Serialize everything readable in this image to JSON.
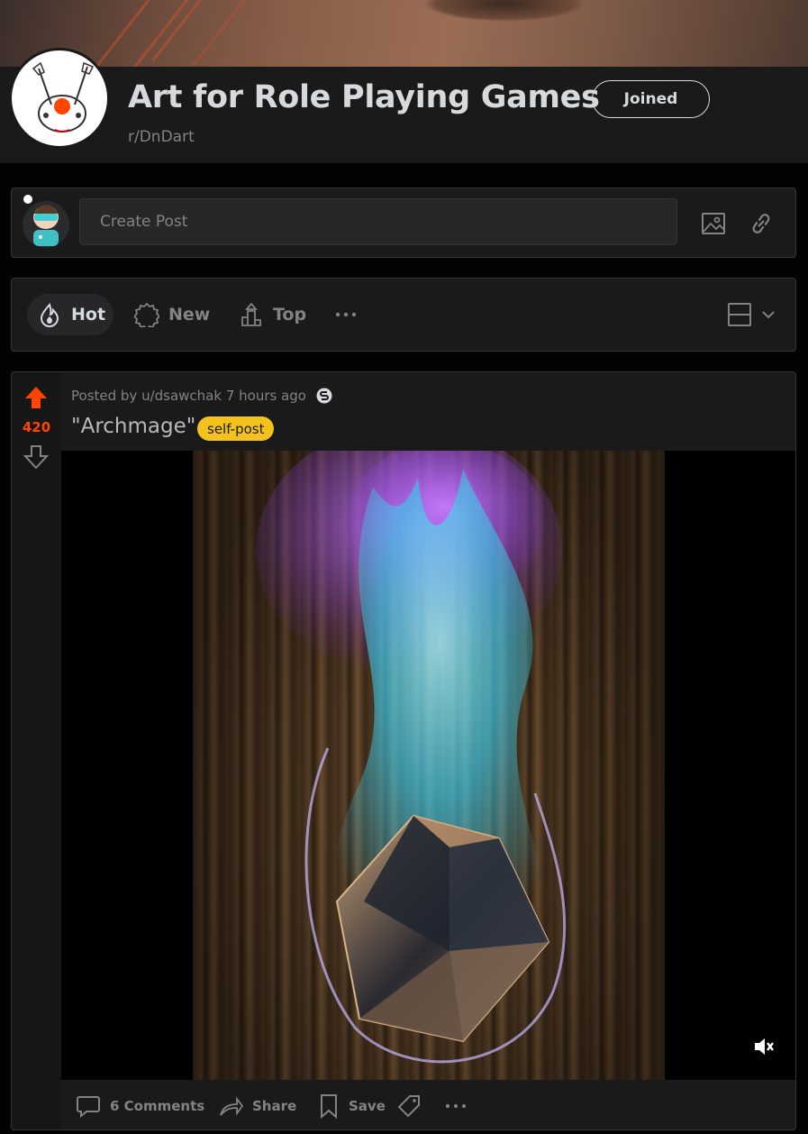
{
  "subreddit": {
    "title": "Art for Role Playing Games",
    "name": "r/DnDart",
    "join_label": "Joined"
  },
  "create_post": {
    "placeholder": "Create Post"
  },
  "sort": {
    "items": [
      {
        "label": "Hot",
        "icon": "flame-icon",
        "active": true
      },
      {
        "label": "New",
        "icon": "new-badge-icon",
        "active": false
      },
      {
        "label": "Top",
        "icon": "top-podium-icon",
        "active": false
      }
    ],
    "more": "more-options-icon",
    "view": "card-view-icon"
  },
  "post": {
    "votes": "420",
    "meta": "Posted by u/dsawchak 7 hours ago",
    "title": "\"Archmage\"",
    "flair": "self-post",
    "actions": {
      "comments": "6 Comments",
      "share": "Share",
      "save": "Save"
    }
  },
  "colors": {
    "accent": "#ff4500",
    "flair_bg": "#f4c21c",
    "card_bg": "#1a1a1b"
  }
}
